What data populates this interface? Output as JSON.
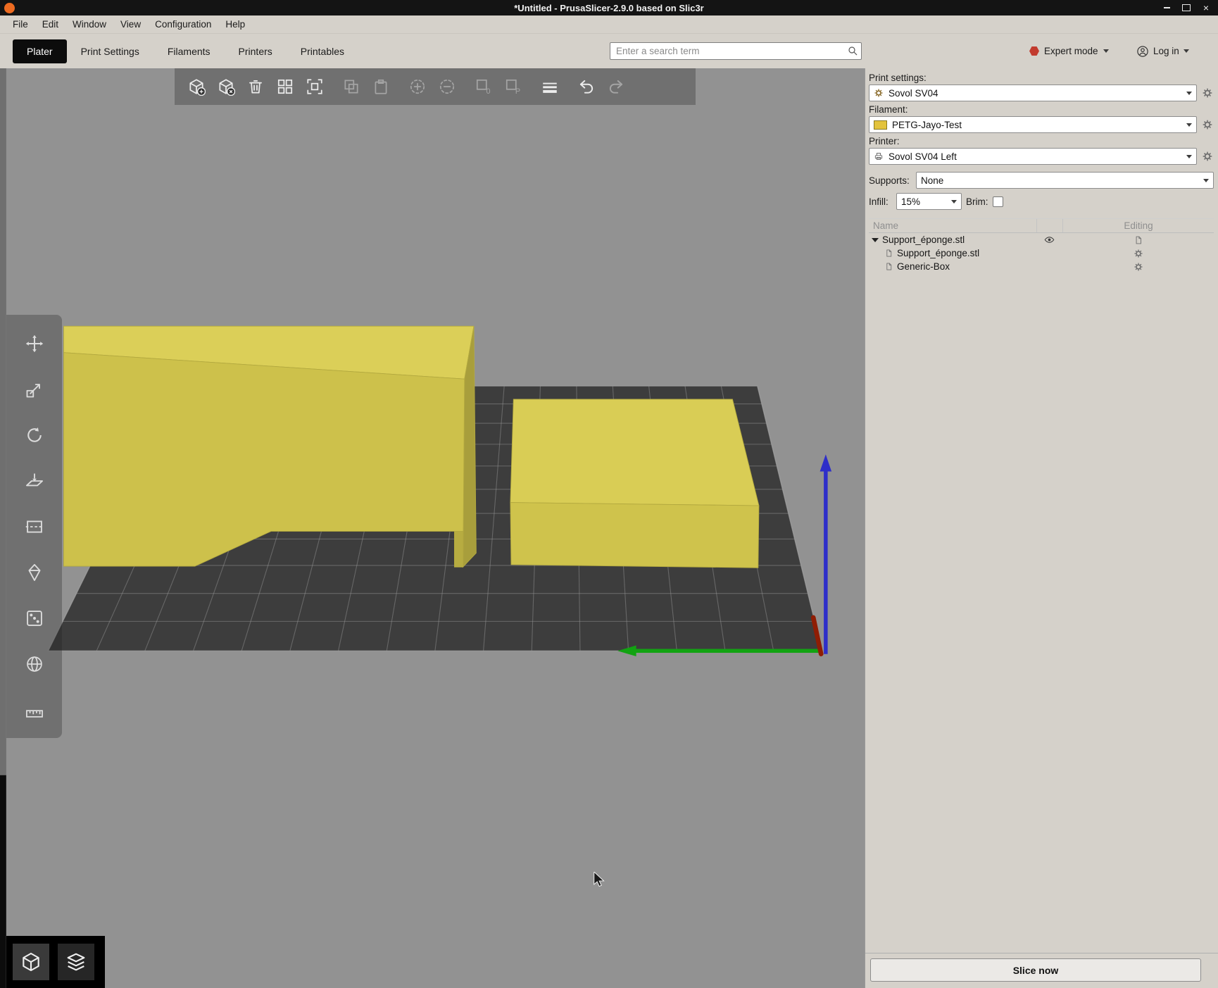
{
  "window": {
    "title": "*Untitled - PrusaSlicer-2.9.0 based on Slic3r",
    "controls": [
      "minimize",
      "maximize",
      "close"
    ]
  },
  "menubar": {
    "items": [
      "File",
      "Edit",
      "Window",
      "View",
      "Configuration",
      "Help"
    ]
  },
  "tabbar": {
    "tabs": [
      "Plater",
      "Print Settings",
      "Filaments",
      "Printers",
      "Printables"
    ],
    "active_tab": "Plater",
    "search": {
      "placeholder": "Enter a search term"
    },
    "mode": {
      "label": "Expert mode",
      "badge_color": "#c23b2e"
    },
    "login": {
      "label": "Log in"
    }
  },
  "viewport": {
    "top_toolbar": [
      "add-object",
      "delete-object",
      "delete-all",
      "arrange",
      "arrange-current-bed",
      "copy",
      "paste",
      "increase-instances",
      "decrease-instances",
      "split-to-objects",
      "split-to-parts",
      "variable-layer-height",
      "undo",
      "redo"
    ],
    "left_toolbar": [
      "move",
      "scale",
      "rotate",
      "place-on-face",
      "cut",
      "paint-supports",
      "seam-painting",
      "multimaterial-painting",
      "measure"
    ],
    "view_switcher": [
      "3d-editor-view",
      "preview-view"
    ],
    "scene": {
      "background_color": "#929292",
      "bed_color": "#3d3d3d",
      "grid_color": "#9b9b9b",
      "object_color": "#d9cd55",
      "objects": [
        "Support_éponge.stl",
        "Generic-Box"
      ],
      "axes": {
        "x_color": "#8f1d04",
        "y_color": "#12a312",
        "z_color": "#2e2ec9"
      }
    }
  },
  "sidebar": {
    "print_settings": {
      "label": "Print settings:",
      "value": "Sovol SV04"
    },
    "filament": {
      "label": "Filament:",
      "value": "PETG-Jayo-Test",
      "swatch_color": "#e3c33c"
    },
    "printer": {
      "label": "Printer:",
      "value": "Sovol SV04 Left"
    },
    "supports": {
      "label": "Supports:",
      "value": "None"
    },
    "infill": {
      "label": "Infill:",
      "value": "15%"
    },
    "brim": {
      "label": "Brim:",
      "checked": false
    },
    "object_list": {
      "columns": {
        "name": "Name",
        "editing": "Editing"
      },
      "rows": [
        {
          "label": "Support_éponge.stl",
          "level": 0,
          "expanded": true,
          "visible": true
        },
        {
          "label": "Support_éponge.stl",
          "level": 1
        },
        {
          "label": "Generic-Box",
          "level": 1
        }
      ]
    },
    "slice_button_label": "Slice now"
  }
}
